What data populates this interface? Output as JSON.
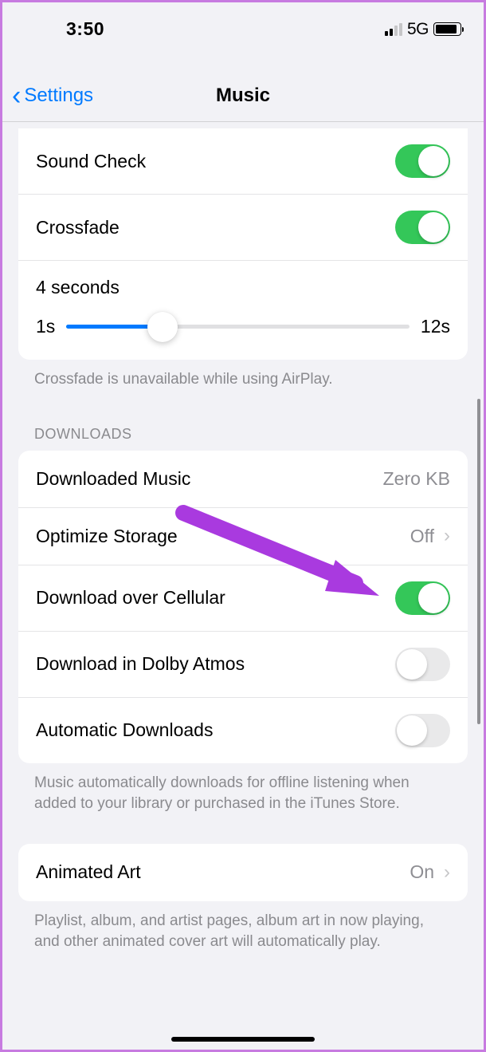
{
  "statusBar": {
    "time": "3:50",
    "network": "5G"
  },
  "nav": {
    "back": "Settings",
    "title": "Music"
  },
  "playback": {
    "soundCheck": {
      "label": "Sound Check",
      "on": true
    },
    "crossfade": {
      "label": "Crossfade",
      "on": true
    },
    "crossfadeDuration": "4 seconds",
    "sliderMin": "1s",
    "sliderMax": "12s",
    "footer": "Crossfade is unavailable while using AirPlay."
  },
  "downloads": {
    "header": "DOWNLOADS",
    "downloadedMusic": {
      "label": "Downloaded Music",
      "value": "Zero KB"
    },
    "optimizeStorage": {
      "label": "Optimize Storage",
      "value": "Off"
    },
    "downloadOverCellular": {
      "label": "Download over Cellular",
      "on": true
    },
    "downloadDolbyAtmos": {
      "label": "Download in Dolby Atmos",
      "on": false
    },
    "automaticDownloads": {
      "label": "Automatic Downloads",
      "on": false
    },
    "footer": "Music automatically downloads for offline listening when added to your library or purchased in the iTunes Store."
  },
  "animatedArt": {
    "label": "Animated Art",
    "value": "On",
    "footer": "Playlist, album, and artist pages, album art in now playing, and other animated cover art will automatically play."
  },
  "annotation": {
    "arrowColor": "#a93adf"
  }
}
